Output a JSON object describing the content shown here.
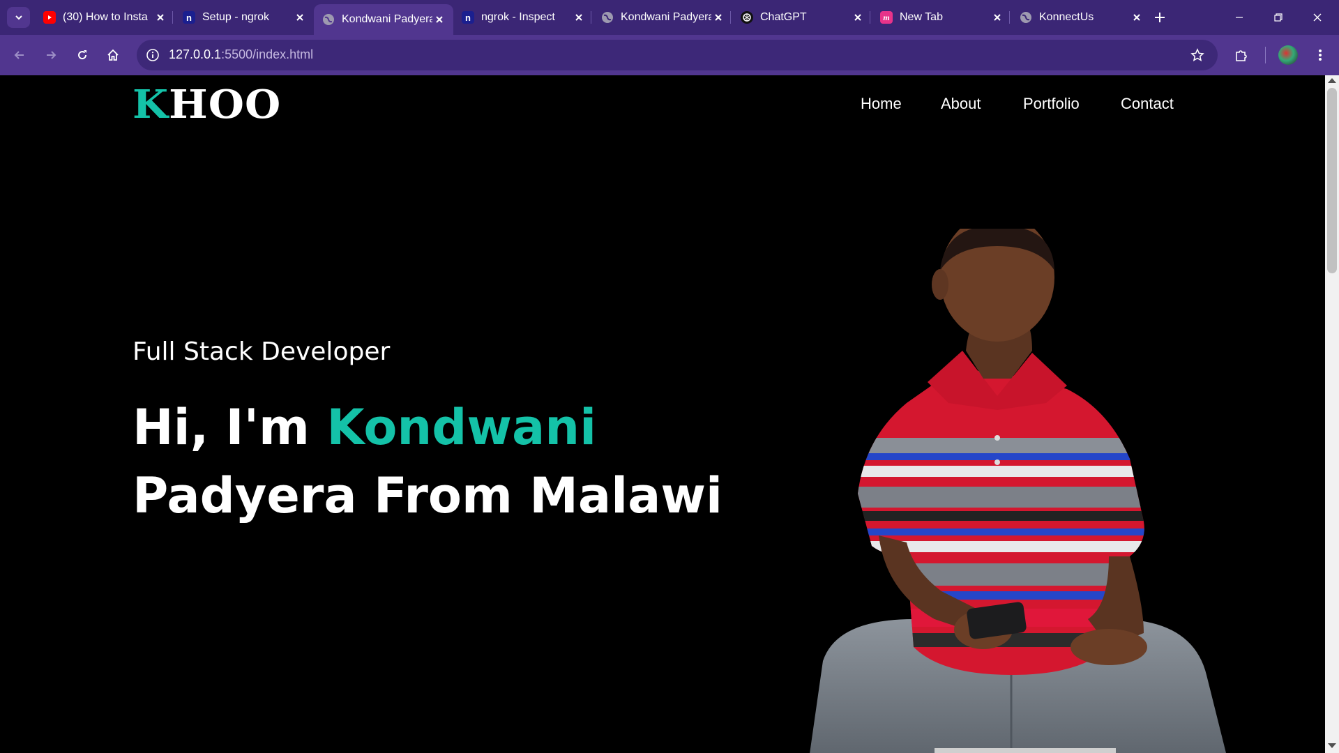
{
  "browser": {
    "tabs": [
      {
        "title": "(30) How to Insta",
        "favicon": "youtube-icon",
        "active": false
      },
      {
        "title": "Setup - ngrok",
        "favicon": "ngrok-icon",
        "active": false
      },
      {
        "title": "Kondwani Padyera",
        "favicon": "globe-icon",
        "active": true
      },
      {
        "title": "ngrok - Inspect",
        "favicon": "ngrok-icon",
        "active": false
      },
      {
        "title": "Kondwani Padyera",
        "favicon": "globe-icon",
        "active": false
      },
      {
        "title": "ChatGPT",
        "favicon": "chatgpt-icon",
        "active": false
      },
      {
        "title": "New Tab",
        "favicon": "m-icon",
        "active": false
      },
      {
        "title": "KonnectUs",
        "favicon": "globe-icon",
        "active": false
      }
    ],
    "address": {
      "host": "127.0.0.1",
      "rest": ":5500/index.html"
    },
    "colors": {
      "frame": "#3b2675",
      "toolbar": "#51368f",
      "omnibox": "#3d2878"
    }
  },
  "site": {
    "logo": {
      "accent": "K",
      "rest": "HOO"
    },
    "nav": [
      "Home",
      "About",
      "Portfolio",
      "Contact"
    ],
    "hero": {
      "subtitle": "Full Stack Developer",
      "greeting": "Hi, I'm ",
      "name": "Kondwani",
      "line2": "Padyera From Malawi"
    },
    "colors": {
      "accent": "#14c2a8",
      "background": "#000000",
      "text": "#ffffff"
    }
  }
}
